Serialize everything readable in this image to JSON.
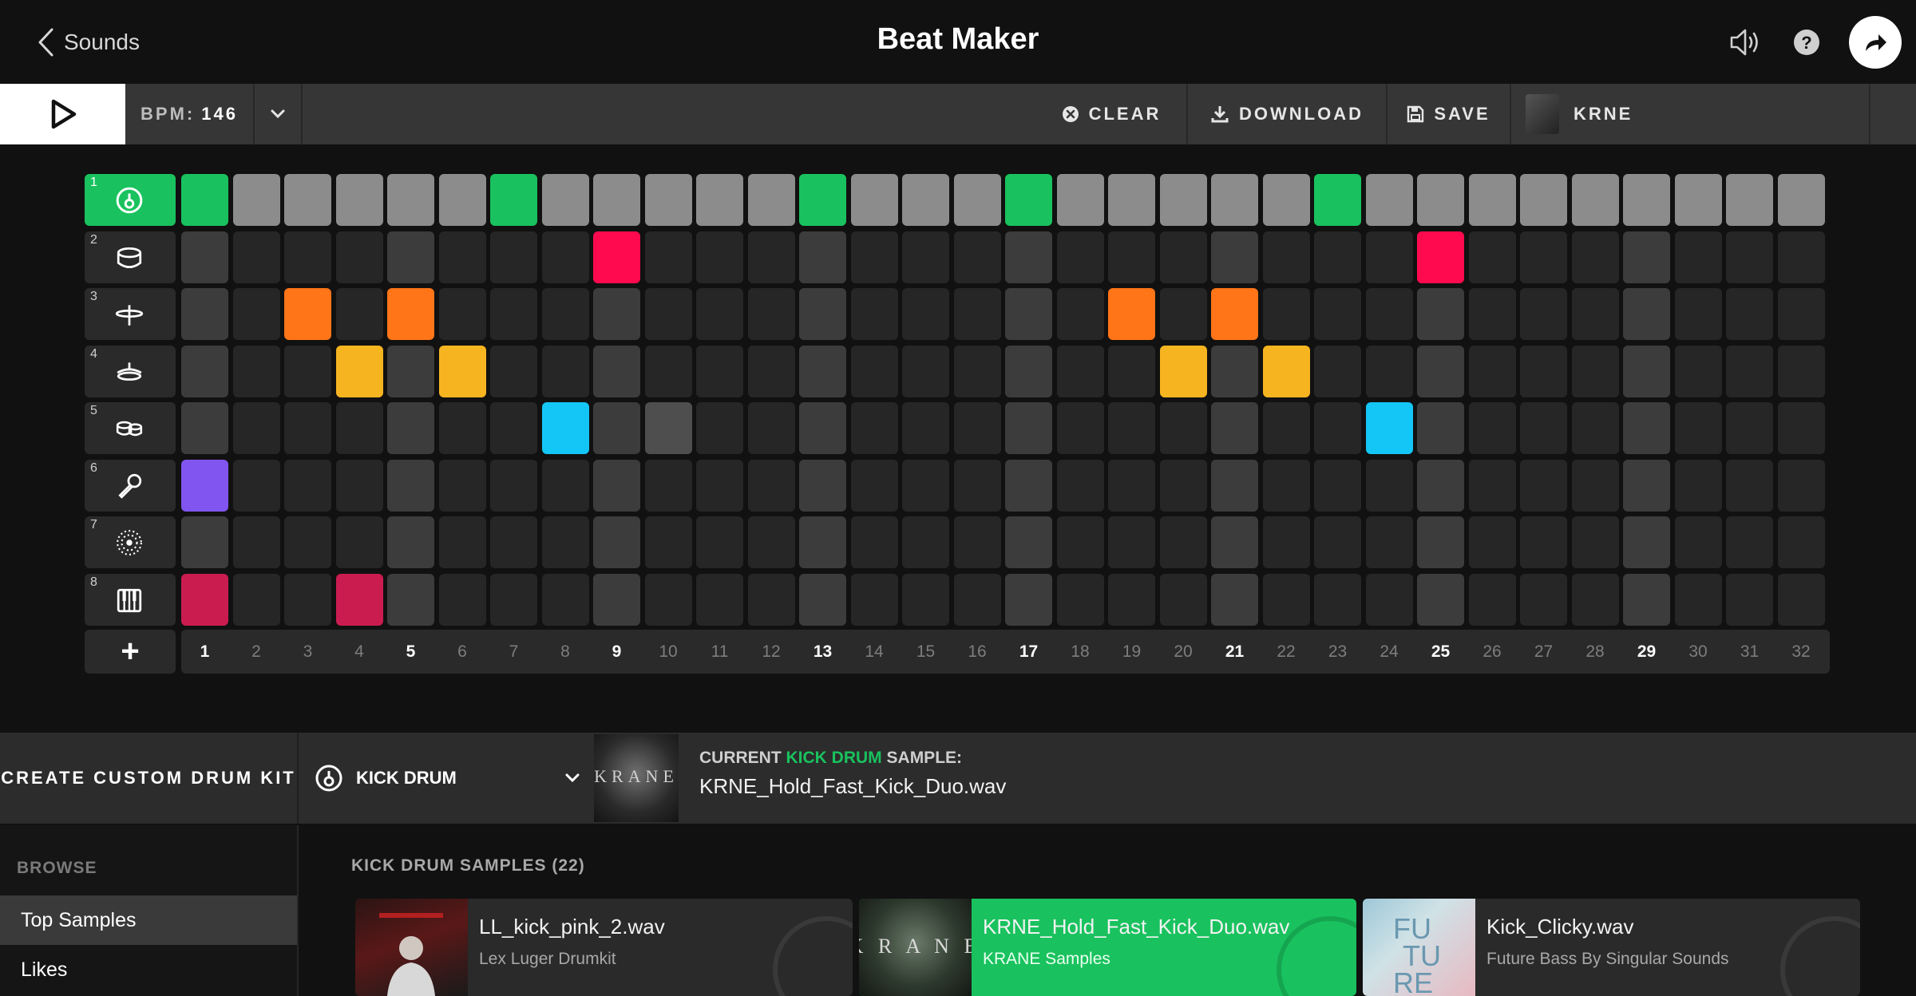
{
  "header": {
    "back_label": "Sounds",
    "title": "Beat Maker"
  },
  "toolbar": {
    "bpm_label": "BPM:",
    "bpm_value": "146",
    "clear_label": "CLEAR",
    "download_label": "DOWNLOAD",
    "save_label": "SAVE",
    "artist_label": "KRNE"
  },
  "sequencer": {
    "steps": 32,
    "step_numbers": [
      "1",
      "2",
      "3",
      "4",
      "5",
      "6",
      "7",
      "8",
      "9",
      "10",
      "11",
      "12",
      "13",
      "14",
      "15",
      "16",
      "17",
      "18",
      "19",
      "20",
      "21",
      "22",
      "23",
      "24",
      "25",
      "26",
      "27",
      "28",
      "29",
      "30",
      "31",
      "32"
    ],
    "major_steps": [
      1,
      5,
      9,
      13,
      17,
      21,
      25,
      29
    ],
    "selected_track": 1,
    "tracks": [
      {
        "number": "1",
        "icon": "kick-drum-icon",
        "color": "#19c25e",
        "active_steps": [
          1,
          7,
          13,
          17,
          23
        ]
      },
      {
        "number": "2",
        "icon": "snare-drum-icon",
        "color": "#ff0a4e",
        "active_steps": [
          9,
          25
        ]
      },
      {
        "number": "3",
        "icon": "hihat-icon",
        "color": "#ff7518",
        "active_steps": [
          3,
          5,
          19,
          21
        ]
      },
      {
        "number": "4",
        "icon": "cymbal-icon",
        "color": "#f7b421",
        "active_steps": [
          4,
          6,
          20,
          22
        ]
      },
      {
        "number": "5",
        "icon": "tom-drums-icon",
        "color": "#14c6f5",
        "active_steps": [
          8,
          24
        ]
      },
      {
        "number": "6",
        "icon": "microphone-icon",
        "color": "#8155ef",
        "active_steps": [
          1
        ]
      },
      {
        "number": "7",
        "icon": "fx-icon",
        "color": "#ffffff",
        "active_steps": []
      },
      {
        "number": "8",
        "icon": "keys-icon",
        "color": "#cb1c50",
        "active_steps": [
          1,
          4
        ]
      }
    ],
    "extra_lit_steps": [
      {
        "track": 5,
        "step": 10
      }
    ],
    "add_label": "+"
  },
  "kit": {
    "create_label": "CREATE CUSTOM DRUM KIT",
    "selected_instrument": "KICK DRUM",
    "art_text": "KRANE",
    "current_prefix": "CURRENT",
    "current_highlight": "KICK DRUM",
    "current_suffix": "SAMPLE:",
    "current_file": "KRNE_Hold_Fast_Kick_Duo.wav"
  },
  "browse": {
    "label": "BROWSE",
    "items": [
      {
        "label": "Top Samples",
        "selected": true
      },
      {
        "label": "Likes",
        "selected": false
      }
    ]
  },
  "samples": {
    "title": "KICK DRUM SAMPLES (22)",
    "items": [
      {
        "name": "LL_kick_pink_2.wav",
        "pack": "Lex Luger Drumkit",
        "active": false
      },
      {
        "name": "KRNE_Hold_Fast_Kick_Duo.wav",
        "pack": "KRANE Samples",
        "active": true
      },
      {
        "name": "Kick_Clicky.wav",
        "pack": "Future Bass By Singular Sounds",
        "active": false
      }
    ]
  },
  "colors": {
    "accent_green": "#19c25e",
    "background": "#111111",
    "toolbar": "#363636"
  }
}
